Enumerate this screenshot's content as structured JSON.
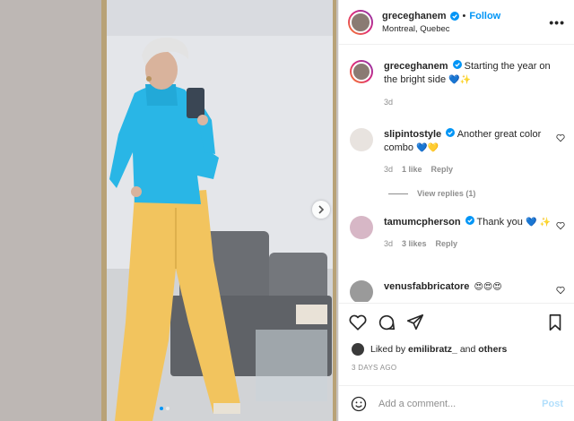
{
  "post": {
    "author": "greceghanem",
    "follow_separator": "•",
    "follow_label": "Follow",
    "location": "Montreal, Quebec",
    "more_label": "•••",
    "caption": "Starting the year on the bright side",
    "caption_emojis": "💙✨",
    "caption_age": "3d"
  },
  "comments": [
    {
      "user": "slipintostyle",
      "text": "Another great color combo",
      "emojis": "💙💛",
      "age": "3d",
      "likes": "1 like",
      "reply": "Reply"
    },
    {
      "user": "tamumcpherson",
      "text": "Thank you",
      "emojis": "💙 ✨",
      "age": "3d",
      "likes": "3 likes",
      "reply": "Reply"
    },
    {
      "user": "venusfabbricatore",
      "text": "",
      "emojis": "😍😍😍"
    }
  ],
  "view_replies": "View replies (1)",
  "liked_by": {
    "prefix": "Liked by",
    "user": "emilibratz_",
    "joiner": "and",
    "others": "others"
  },
  "posted": "3 DAYS AGO",
  "add_comment": {
    "placeholder": "Add a comment...",
    "post_label": "Post"
  },
  "carousel": {
    "count": 2,
    "active": 0
  },
  "colors": {
    "accent": "#0095f6",
    "post_disabled": "#b2dffc",
    "sweater": "#29b6e6",
    "pants": "#f2c45e"
  },
  "icons": [
    "verified-icon",
    "heart-icon",
    "comment-icon",
    "share-icon",
    "bookmark-icon",
    "emoji-icon",
    "chevron-right-icon",
    "more-icon"
  ]
}
